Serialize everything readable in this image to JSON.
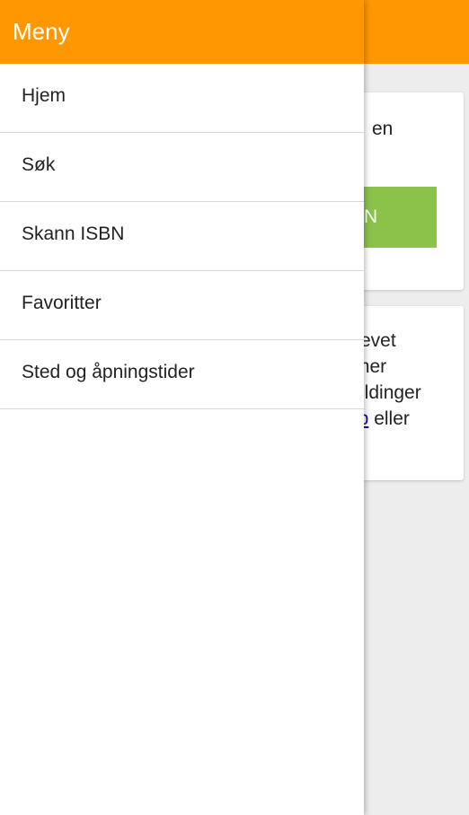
{
  "colors": {
    "header": "#ff9800",
    "action_green": "#8bc34a",
    "link_blue": "#1a0dab",
    "background": "#ededed"
  },
  "drawer": {
    "title": "Meny",
    "items": [
      {
        "label": "Hjem"
      },
      {
        "label": "Søk"
      },
      {
        "label": "Skann ISBN"
      },
      {
        "label": "Favoritter"
      },
      {
        "label": "Sted og åpningstider"
      }
    ]
  },
  "background_page": {
    "card1": {
      "text": "en",
      "action_label": "N"
    },
    "card2": {
      "lines": [
        "revet",
        "mer",
        "eldinger"
      ],
      "link_fragment": "ib",
      "after_link": " eller"
    }
  }
}
